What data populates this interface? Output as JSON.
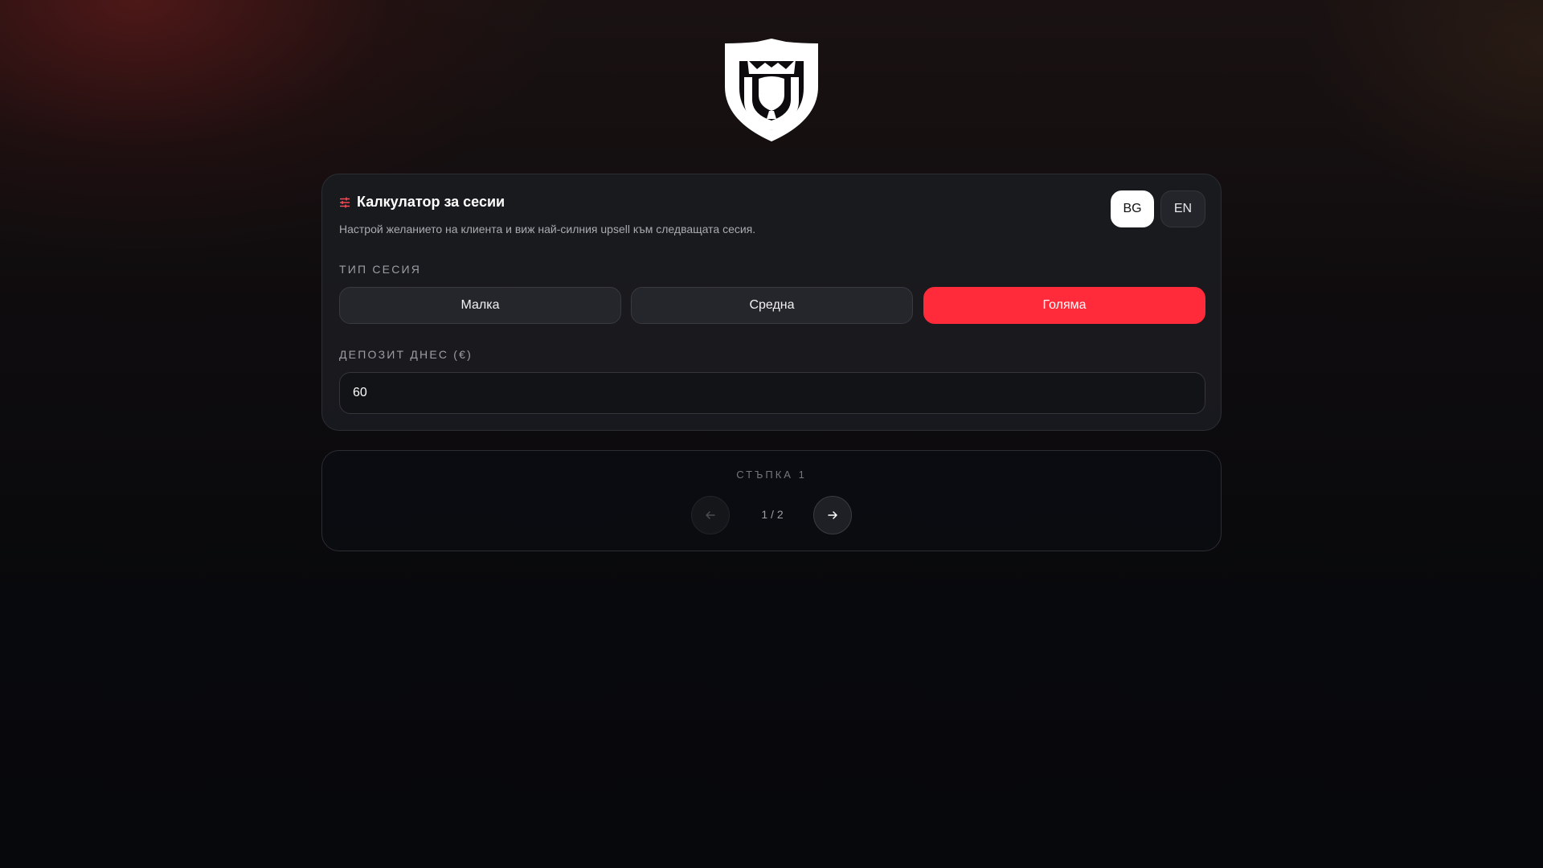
{
  "logo": {
    "icon": "shield-crown-logo",
    "color": "#ffffff"
  },
  "calculator": {
    "title_icon": "sliders-icon",
    "title": "Калкулатор за сесии",
    "subtitle": "Настрой желанието на клиента и виж най-силния upsell към следващата сесия.",
    "languages": [
      {
        "label": "BG",
        "active": true
      },
      {
        "label": "EN",
        "active": false
      }
    ],
    "session_type_label": "ТИП СЕСИЯ",
    "session_types": [
      {
        "label": "Малка",
        "selected": false
      },
      {
        "label": "Средна",
        "selected": false
      },
      {
        "label": "Голяма",
        "selected": true
      }
    ],
    "deposit_label": "ДЕПОЗИТ ДНЕС (€)",
    "deposit_value": "60"
  },
  "stepper": {
    "step_label": "СТЪПКА 1",
    "page_indicator": "1 / 2",
    "prev_icon": "arrow-left-icon",
    "next_icon": "arrow-right-icon"
  },
  "colors": {
    "accent": "#ff2b3a",
    "card_bg": "#1a1b1f",
    "border": "#2c2e33"
  }
}
